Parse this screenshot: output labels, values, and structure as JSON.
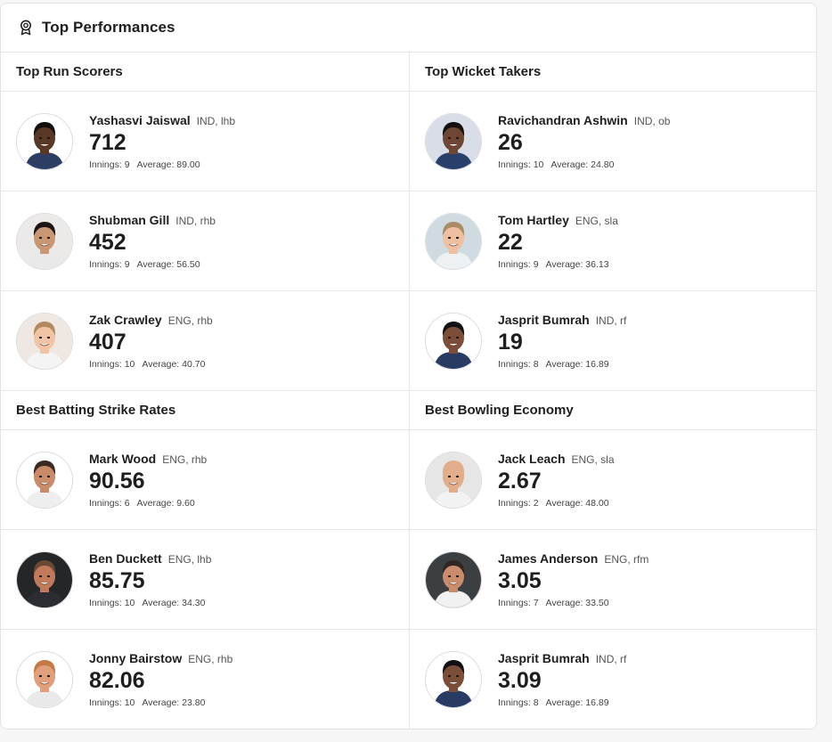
{
  "header": {
    "title": "Top Performances",
    "icon": "award-icon"
  },
  "sections": {
    "top_run_scorers": {
      "title": "Top Run Scorers",
      "players": [
        {
          "name": "Yashasvi Jaiswal",
          "meta": "IND, lhb",
          "value": "712",
          "innings": "Innings: 9",
          "average": "Average: 89.00",
          "skin": "#5a3826",
          "hair": "#151010",
          "bg": "#ffffff",
          "shirt": "#2c3e63"
        },
        {
          "name": "Shubman Gill",
          "meta": "IND, rhb",
          "value": "452",
          "innings": "Innings: 9",
          "average": "Average: 56.50",
          "skin": "#c99773",
          "hair": "#1b1412",
          "bg": "#eceae8",
          "shirt": "#e9e9ea"
        },
        {
          "name": "Zak Crawley",
          "meta": "ENG, rhb",
          "value": "407",
          "innings": "Innings: 10",
          "average": "Average: 40.70",
          "skin": "#f0c4a5",
          "hair": "#b38a5d",
          "bg": "#efe8e2",
          "shirt": "#f4f4f4"
        }
      ]
    },
    "top_wicket_takers": {
      "title": "Top Wicket Takers",
      "players": [
        {
          "name": "Ravichandran Ashwin",
          "meta": "IND, ob",
          "value": "26",
          "innings": "Innings: 10",
          "average": "Average: 24.80",
          "skin": "#6d4634",
          "hair": "#141012",
          "bg": "#d9dde8",
          "shirt": "#2b3f6b"
        },
        {
          "name": "Tom Hartley",
          "meta": "ENG, sla",
          "value": "22",
          "innings": "Innings: 9",
          "average": "Average: 36.13",
          "skin": "#eebfa0",
          "hair": "#a98b66",
          "bg": "#cfdbe0",
          "shirt": "#eef1f3"
        },
        {
          "name": "Jasprit Bumrah",
          "meta": "IND, rf",
          "value": "19",
          "innings": "Innings: 8",
          "average": "Average: 16.89",
          "skin": "#7a4e38",
          "hair": "#121012",
          "bg": "#ffffff",
          "shirt": "#283b63"
        }
      ]
    },
    "best_batting_strike_rates": {
      "title": "Best Batting Strike Rates",
      "players": [
        {
          "name": "Mark Wood",
          "meta": "ENG, rhb",
          "value": "90.56",
          "innings": "Innings: 6",
          "average": "Average: 9.60",
          "skin": "#c98b69",
          "hair": "#3a2a22",
          "bg": "#ffffff",
          "shirt": "#eeeeee"
        },
        {
          "name": "Ben Duckett",
          "meta": "ENG, lhb",
          "value": "85.75",
          "innings": "Innings: 10",
          "average": "Average: 34.30",
          "skin": "#c27a5c",
          "hair": "#6a4a36",
          "bg": "#242628",
          "shirt": "#2b2d33"
        },
        {
          "name": "Jonny Bairstow",
          "meta": "ENG, rhb",
          "value": "82.06",
          "innings": "Innings: 10",
          "average": "Average: 23.80",
          "skin": "#e1a07b",
          "hair": "#c47a45",
          "bg": "#ffffff",
          "shirt": "#e9e9ea"
        }
      ]
    },
    "best_bowling_economy": {
      "title": "Best Bowling Economy",
      "players": [
        {
          "name": "Jack Leach",
          "meta": "ENG, sla",
          "value": "2.67",
          "innings": "Innings: 2",
          "average": "Average: 48.00",
          "skin": "#e2ad8b",
          "hair": "#e2ad8b",
          "bg": "#e6e6e6",
          "shirt": "#f2f2f2"
        },
        {
          "name": "James Anderson",
          "meta": "ENG, rfm",
          "value": "3.05",
          "innings": "Innings: 7",
          "average": "Average: 33.50",
          "skin": "#c98d6e",
          "hair": "#2f2620",
          "bg": "#3c3f42",
          "shirt": "#f1f1f1"
        },
        {
          "name": "Jasprit Bumrah",
          "meta": "IND, rf",
          "value": "3.09",
          "innings": "Innings: 8",
          "average": "Average: 16.89",
          "skin": "#7a4e38",
          "hair": "#121012",
          "bg": "#ffffff",
          "shirt": "#283b63"
        }
      ]
    }
  }
}
